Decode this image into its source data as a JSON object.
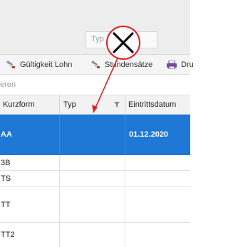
{
  "header": {
    "type_placeholder": "Typ"
  },
  "toolbar": {
    "validity_label": "Gültigkeit Lohn",
    "hours_label": "Stundensätze",
    "print_label": "Dru"
  },
  "filter": {
    "placeholder": "eren"
  },
  "grid": {
    "columns": [
      "Kurzform",
      "Typ",
      "Eintrittsdatum"
    ],
    "rows": [
      {
        "kurzform": "AA",
        "typ": "",
        "eintritt": "01.12.2020",
        "selected": true
      },
      {
        "kurzform": "3B",
        "typ": "",
        "eintritt": ""
      },
      {
        "kurzform": "TS",
        "typ": "",
        "eintritt": ""
      },
      {
        "kurzform": "TT",
        "typ": "",
        "eintritt": ""
      },
      {
        "kurzform": "TT2",
        "typ": "",
        "eintritt": ""
      }
    ]
  },
  "annotation": {
    "marker": "close-x-marker",
    "color": "#e02020"
  },
  "colors": {
    "selection": "#1f77d6"
  }
}
